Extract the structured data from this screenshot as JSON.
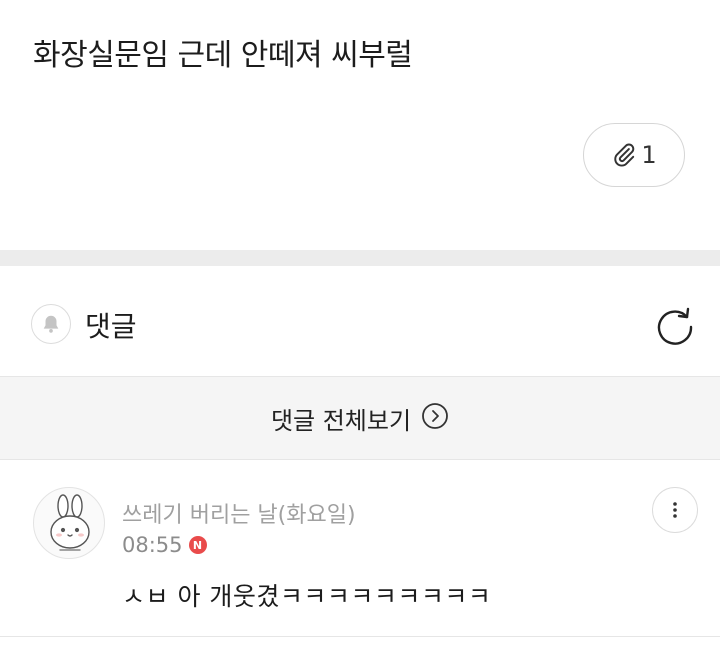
{
  "post": {
    "text": "화장실문임 근데 안떼져 씨부럴",
    "attachment_count": "1",
    "attachment_icon": "paperclip-icon"
  },
  "comments_section": {
    "title": "댓글",
    "bell_icon": "bell-icon",
    "refresh_icon": "refresh-icon",
    "view_all_label": "댓글 전체보기",
    "view_all_icon": "chevron-right-circle-icon"
  },
  "comment": {
    "author": "쓰레기 버리는 날(화요일)",
    "time": "08:55",
    "new_badge": "N",
    "text": "ㅅㅂ 아 개웃겼ㅋㅋㅋㅋㅋㅋㅋㅋㅋ",
    "avatar_icon": "rabbit-avatar-icon",
    "more_icon": "more-vertical-icon"
  },
  "colors": {
    "divider": "#ececec",
    "view_all_bg": "#f5f5f5",
    "badge": "#e94b4b",
    "muted_text": "#a0a0a0"
  }
}
